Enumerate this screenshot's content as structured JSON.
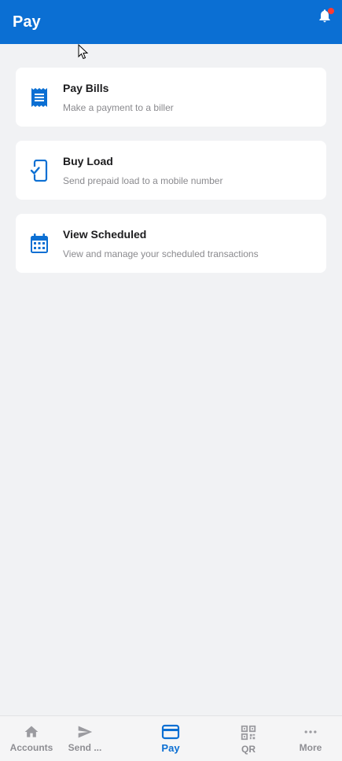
{
  "header": {
    "title": "Pay",
    "notification_icon": "bell-icon",
    "notification_badge_color": "#ff3b30"
  },
  "colors": {
    "brand": "#0b6fd3",
    "background": "#f1f2f4",
    "card": "#ffffff",
    "muted_text": "#8a8a8e"
  },
  "cards": [
    {
      "title": "Pay Bills",
      "subtitle": "Make a payment to a biller",
      "icon": "receipt-icon"
    },
    {
      "title": "Buy Load",
      "subtitle": "Send prepaid load to a mobile number",
      "icon": "phone-check-icon"
    },
    {
      "title": "View Scheduled",
      "subtitle": "View and manage your scheduled transactions",
      "icon": "calendar-icon"
    }
  ],
  "bottom_nav": {
    "active": "Pay",
    "items": [
      {
        "label": "Accounts",
        "icon": "home-icon"
      },
      {
        "label": "Send ...",
        "icon": "send-icon"
      },
      {
        "label": "Pay",
        "icon": "card-icon"
      },
      {
        "label": "QR",
        "icon": "qr-icon"
      },
      {
        "label": "More",
        "icon": "more-icon"
      }
    ]
  }
}
